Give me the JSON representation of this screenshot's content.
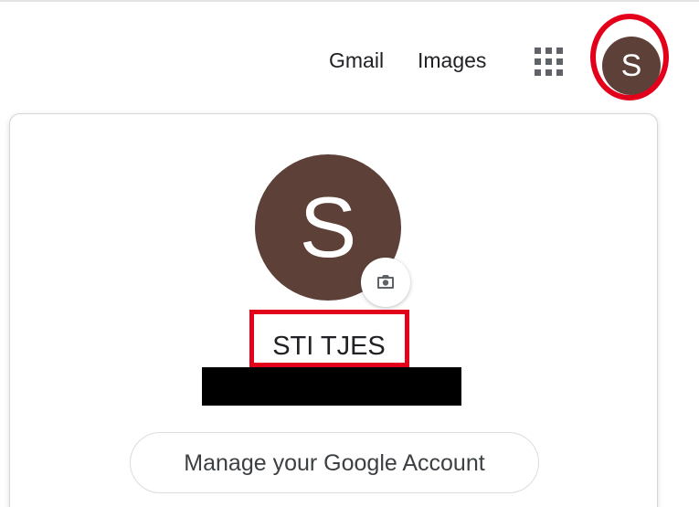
{
  "topbar": {
    "gmail_label": "Gmail",
    "images_label": "Images",
    "apps_icon": "apps-grid-icon",
    "avatar_initial": "S"
  },
  "account_card": {
    "avatar_initial": "S",
    "camera_icon": "camera-icon",
    "account_name": "STI TJES",
    "manage_button_label": "Manage your Google Account"
  },
  "colors": {
    "avatar_bg": "#5d4037",
    "annotation_red": "#e3001b",
    "text": "#202124"
  }
}
